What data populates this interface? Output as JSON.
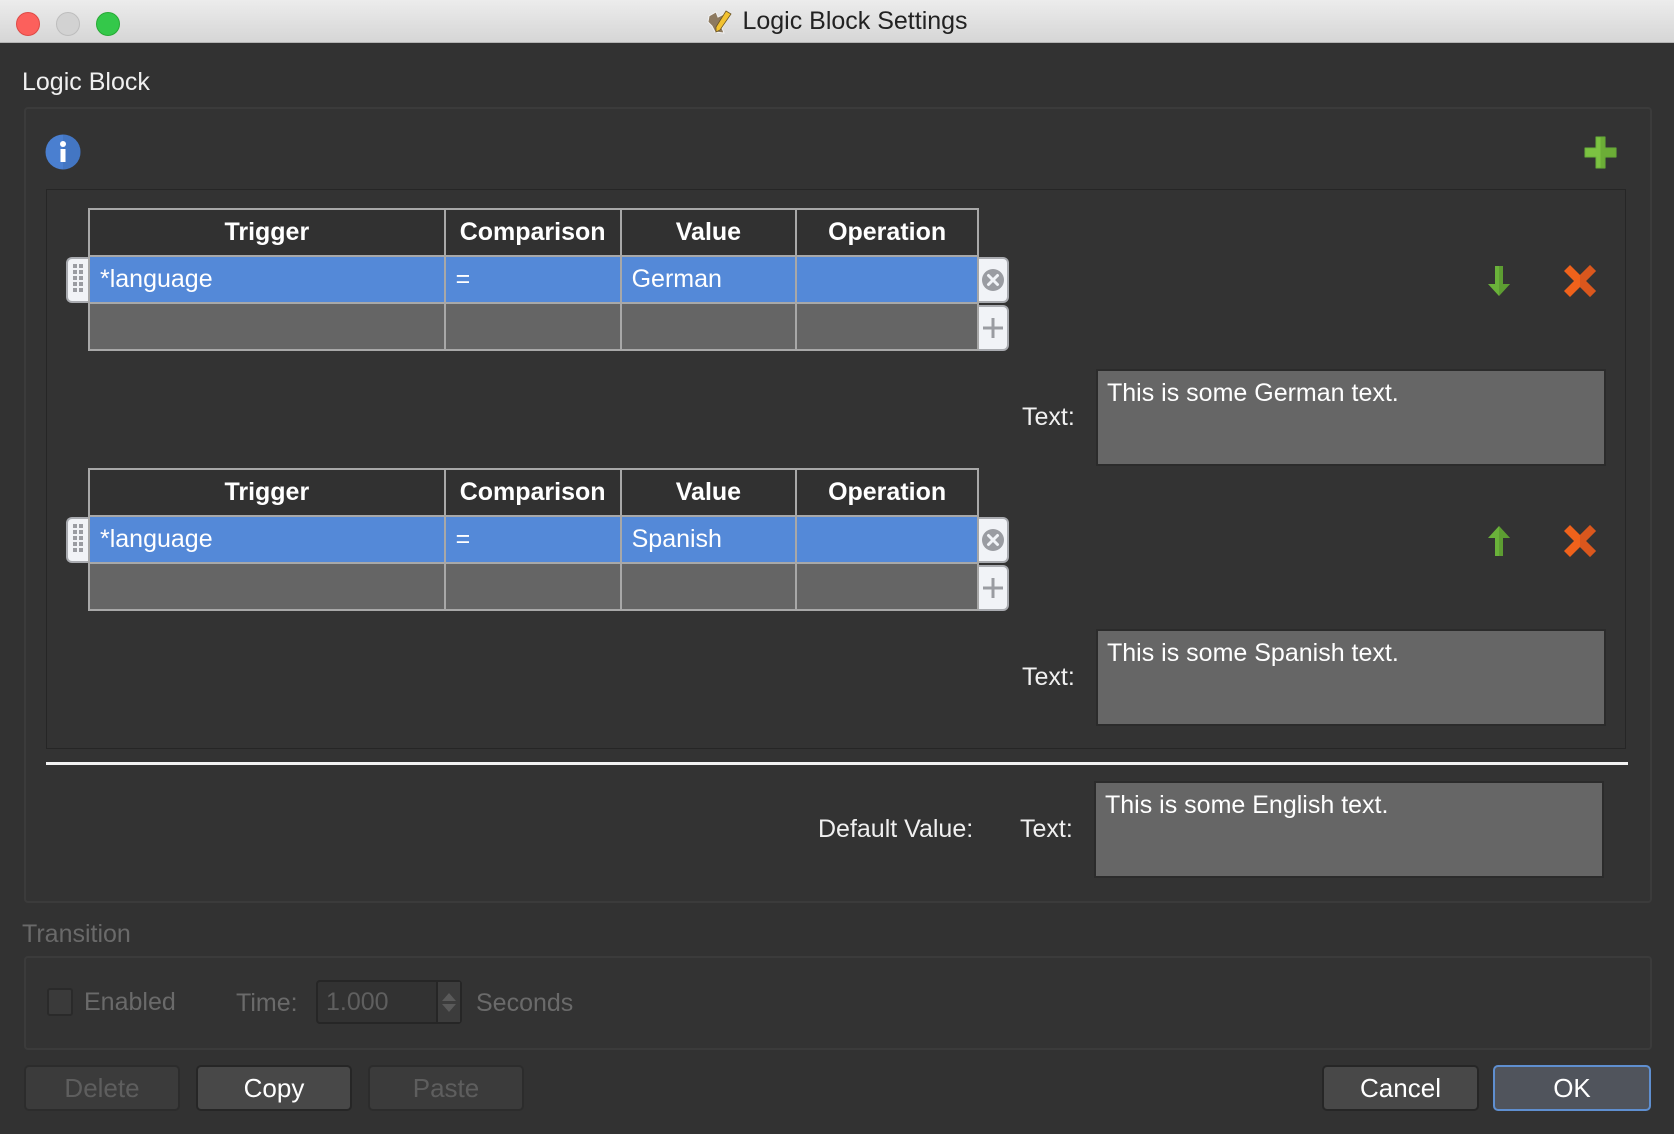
{
  "window": {
    "title": "Logic Block Settings",
    "app_icon": "map-pencil-icon"
  },
  "logic_block": {
    "section_label": "Logic Block",
    "info_icon": "info-icon",
    "add_block_icon": "plus-icon",
    "table_headers": [
      "Trigger",
      "Comparison",
      "Value",
      "Operation"
    ],
    "conditions": [
      {
        "rows": [
          {
            "trigger": "*language",
            "comparison": "=",
            "value": "German",
            "operation": ""
          }
        ],
        "move_icon": "arrow-down-icon",
        "text_label": "Text:",
        "text_value": "This is some German text."
      },
      {
        "rows": [
          {
            "trigger": "*language",
            "comparison": "=",
            "value": "Spanish",
            "operation": ""
          }
        ],
        "move_icon": "arrow-up-icon",
        "text_label": "Text:",
        "text_value": "This is some Spanish text."
      }
    ],
    "default_value_label": "Default Value:",
    "default_text_label": "Text:",
    "default_text_value": "This is some English text."
  },
  "transition": {
    "section_label": "Transition",
    "enabled_label": "Enabled",
    "enabled": false,
    "time_label": "Time:",
    "time_value": "1.000",
    "unit_label": "Seconds"
  },
  "buttons": {
    "delete": "Delete",
    "copy": "Copy",
    "paste": "Paste",
    "cancel": "Cancel",
    "ok": "OK"
  },
  "colors": {
    "selection": "#5489d8",
    "add_green": "#6ab23a",
    "delete_orange": "#f0621b",
    "info_blue": "#4a7fd0"
  }
}
